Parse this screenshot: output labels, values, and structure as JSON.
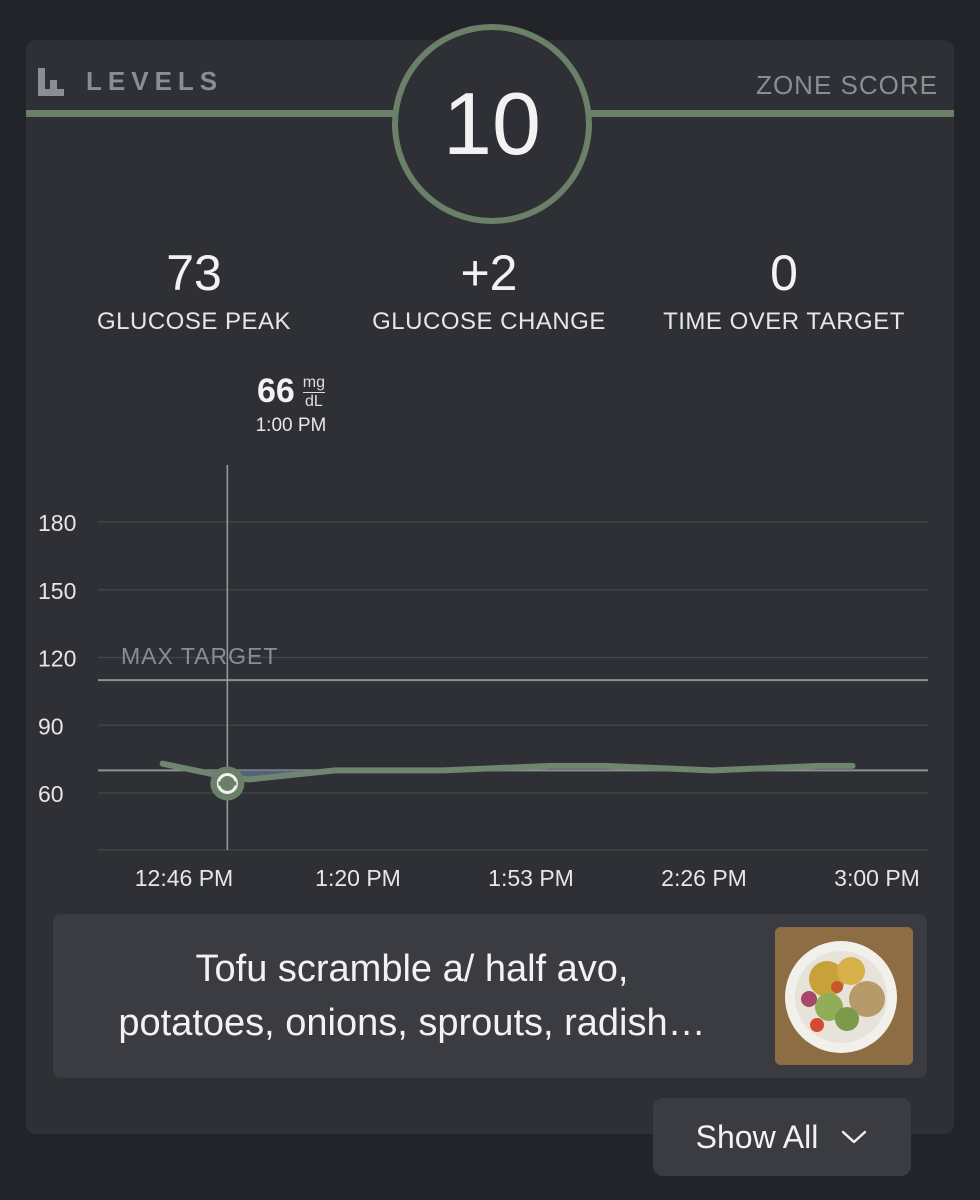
{
  "brand": {
    "name": "LEVELS",
    "logo_icon": "levels-logo-icon"
  },
  "header": {
    "zone_label": "ZONE SCORE",
    "score": "10"
  },
  "stats": [
    {
      "value": "73",
      "label": "GLUCOSE PEAK"
    },
    {
      "value": "+2",
      "label": "GLUCOSE CHANGE"
    },
    {
      "value": "0",
      "label": "TIME OVER TARGET"
    }
  ],
  "readout": {
    "value": "66",
    "unit_top": "mg",
    "unit_bottom": "dL",
    "time": "1:00 PM"
  },
  "chart_data": {
    "type": "line",
    "x_tick_labels": [
      "12:46 PM",
      "1:20 PM",
      "1:53 PM",
      "2:26 PM",
      "3:00 PM"
    ],
    "xlim_minutes_after_noon": [
      46,
      180
    ],
    "y_ticks": [
      180,
      150,
      120,
      90,
      60
    ],
    "ylim": [
      40,
      195
    ],
    "max_target_label": "MAX TARGET",
    "max_target_value": 110,
    "baseline_value": 70,
    "selected_point": {
      "time": "1:00 PM",
      "value": 66
    },
    "series": [
      {
        "color": "#6f8570",
        "time": [
          "12:48 PM",
          "12:52 PM",
          "12:56 PM",
          "1:00 PM",
          "1:04 PM",
          "1:08 PM",
          "1:12 PM",
          "1:16 PM",
          "1:20 PM",
          "1:30 PM",
          "1:40 PM",
          "1:50 PM",
          "2:00 PM",
          "2:10 PM",
          "2:20 PM",
          "2:30 PM",
          "2:40 PM",
          "2:50 PM",
          "2:56 PM"
        ],
        "values": [
          73,
          71,
          69,
          67,
          66,
          67,
          68,
          69,
          70,
          70,
          70,
          71,
          72,
          72,
          71,
          70,
          71,
          72,
          72
        ]
      }
    ]
  },
  "meal": {
    "line1": "Tofu scramble a/ half avo,",
    "line2": "potatoes, onions, sprouts, radish…"
  },
  "show_all": {
    "label": "Show All",
    "icon": "chevron-down-icon"
  },
  "colors": {
    "accent": "#6b8069",
    "background": "#232429",
    "card": "#2e3035"
  }
}
